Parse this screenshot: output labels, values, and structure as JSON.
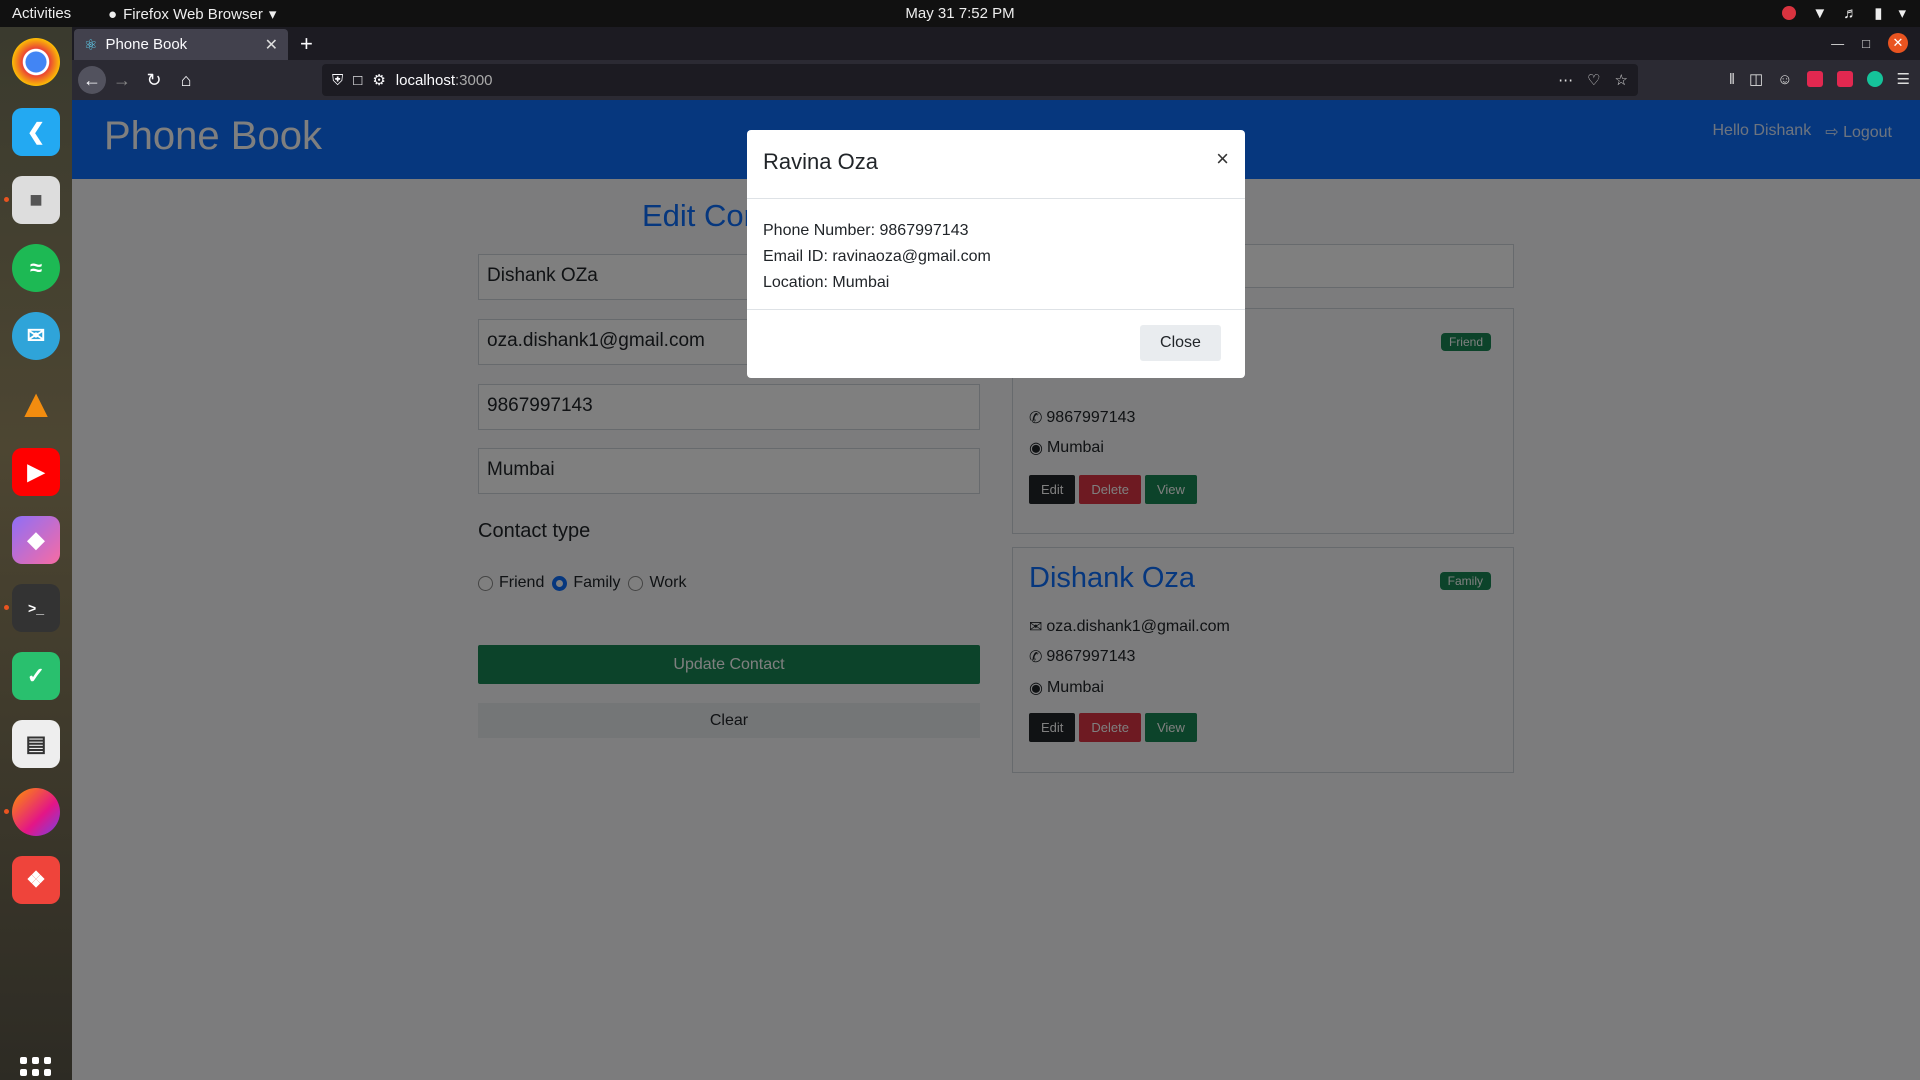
{
  "os": {
    "activities": "Activities",
    "app_menu": "Firefox Web Browser",
    "clock": "May 31  7:52 PM"
  },
  "dock": {
    "apps": [
      "chrome-icon",
      "vscode-icon",
      "files-icon",
      "spotify-icon",
      "mail-icon",
      "vlc-icon",
      "youtube-icon",
      "postman-icon",
      "terminal-icon",
      "todo-icon",
      "reader-icon",
      "firefox-icon",
      "anydesk-icon"
    ]
  },
  "browser": {
    "tab_title": "Phone Book",
    "url_host": "localhost",
    "url_port": ":3000"
  },
  "app": {
    "brand": "Phone Book",
    "greeting": "Hello Dishank",
    "logout": "Logout"
  },
  "form": {
    "title": "Edit Contact",
    "name": "Dishank OZa",
    "email": "oza.dishank1@gmail.com",
    "phone": "9867997143",
    "location": "Mumbai",
    "contact_type_label": "Contact type",
    "options": [
      "Friend",
      "Family",
      "Work"
    ],
    "selected": "Family",
    "update_label": "Update Contact",
    "clear_label": "Clear"
  },
  "contacts": [
    {
      "badge": "Friend",
      "phone": "9867997143",
      "location": "Mumbai"
    },
    {
      "name": "Dishank Oza",
      "badge": "Family",
      "email": "oza.dishank1@gmail.com",
      "phone": "9867997143",
      "location": "Mumbai"
    }
  ],
  "card_buttons": {
    "edit": "Edit",
    "delete": "Delete",
    "view": "View"
  },
  "modal": {
    "title": "Ravina Oza",
    "close_x": "×",
    "phone_line": "Phone Number: 9867997143",
    "email_line": "Email ID: ravinaoza@gmail.com",
    "location_line": "Location: Mumbai",
    "close_label": "Close"
  }
}
